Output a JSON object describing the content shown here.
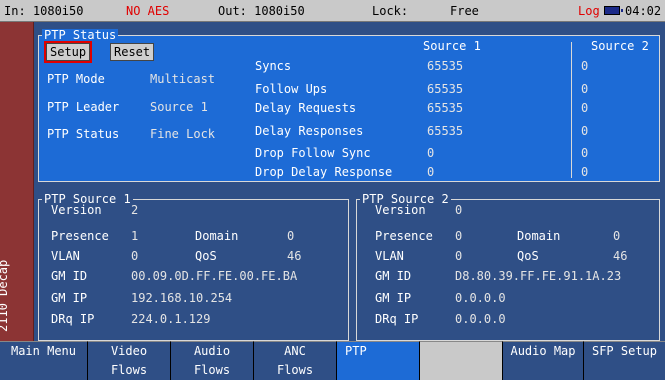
{
  "topbar": {
    "input": "In: 1080i50",
    "audio_status": "NO AES",
    "output": "Out: 1080i50",
    "lock_label": "Lock:",
    "lock_value": "Free",
    "log": "Log",
    "time": "04:02"
  },
  "side_tab": "2110 Decap",
  "status": {
    "title": "PTP Status",
    "setup_label": "Setup",
    "reset_label": "Reset",
    "mode_label": "PTP Mode",
    "mode_value": "Multicast",
    "leader_label": "PTP Leader",
    "leader_value": "Source 1",
    "status_label": "PTP Status",
    "status_value": "Fine Lock",
    "col1": "Source 1",
    "col2": "Source 2",
    "rows": [
      {
        "label": "Syncs",
        "s1": "65535",
        "s2": "0"
      },
      {
        "label": "Follow Ups",
        "s1": "65535",
        "s2": "0"
      },
      {
        "label": "Delay Requests",
        "s1": "65535",
        "s2": "0"
      },
      {
        "label": "Delay Responses",
        "s1": "65535",
        "s2": "0"
      },
      {
        "label": "Drop Follow Sync",
        "s1": "0",
        "s2": "0"
      },
      {
        "label": "Drop Delay Response",
        "s1": "0",
        "s2": "0"
      }
    ]
  },
  "source1": {
    "title": "PTP Source 1",
    "version_label": "Version",
    "version": "2",
    "presence_label": "Presence",
    "presence": "1",
    "domain_label": "Domain",
    "domain": "0",
    "vlan_label": "VLAN",
    "vlan": "0",
    "qos_label": "QoS",
    "qos": "46",
    "gmid_label": "GM ID",
    "gmid": "00.09.0D.FF.FE.00.FE.BA",
    "gmip_label": "GM IP",
    "gmip": "192.168.10.254",
    "drq_label": "DRq IP",
    "drq": "224.0.1.129"
  },
  "source2": {
    "title": "PTP Source 2",
    "version_label": "Version",
    "version": "0",
    "presence_label": "Presence",
    "presence": "0",
    "domain_label": "Domain",
    "domain": "0",
    "vlan_label": "VLAN",
    "vlan": "0",
    "qos_label": "QoS",
    "qos": "46",
    "gmid_label": "GM ID",
    "gmid": "D8.80.39.FF.FE.91.1A.23",
    "gmip_label": "GM IP",
    "gmip": "0.0.0.0",
    "drq_label": "DRq IP",
    "drq": "0.0.0.0"
  },
  "softkeys": [
    {
      "line1": "Main Menu",
      "line2": ""
    },
    {
      "line1": "Video",
      "line2": "Flows"
    },
    {
      "line1": "Audio",
      "line2": "Flows"
    },
    {
      "line1": "ANC",
      "line2": "Flows"
    },
    {
      "line1": "PTP",
      "line2": ""
    },
    {
      "line1": "",
      "line2": ""
    },
    {
      "line1": "Audio Map",
      "line2": ""
    },
    {
      "line1": "SFP Setup",
      "line2": ""
    }
  ]
}
